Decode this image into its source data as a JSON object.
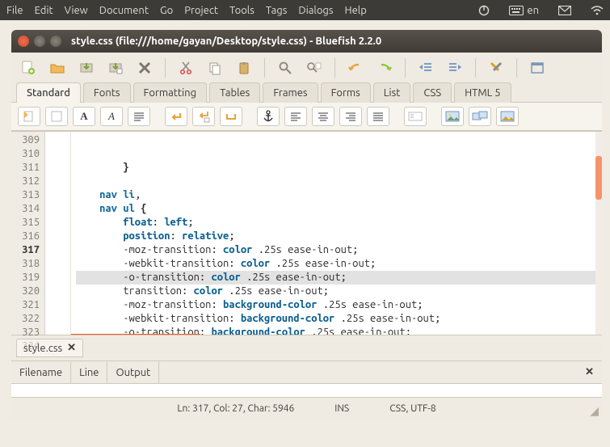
{
  "menubar": {
    "items": [
      "File",
      "Edit",
      "View",
      "Document",
      "Go",
      "Project",
      "Tools",
      "Tags",
      "Dialogs",
      "Help"
    ],
    "lang": "en"
  },
  "window": {
    "title": "style.css (file:///home/gayan/Desktop/style.css) - Bluefish 2.2.0"
  },
  "toolbar_icons": [
    "new-file",
    "open-file",
    "save",
    "save-as",
    "delete",
    "cut",
    "copy",
    "paste",
    "find",
    "find-replace",
    "undo",
    "redo",
    "unindent",
    "indent",
    "preferences",
    "fullscreen"
  ],
  "tabs": [
    "Standard",
    "Fonts",
    "Formatting",
    "Tables",
    "Frames",
    "Forms",
    "List",
    "CSS",
    "HTML 5"
  ],
  "active_tab": 0,
  "toolbar2_icons": [
    "quickstart",
    "body",
    "bold",
    "italic",
    "paragraph",
    "break",
    "nbsp",
    "anchor-in",
    "anchor",
    "align-left",
    "align-center",
    "align-right",
    "align-justify",
    "comment",
    "image",
    "multi-thumb",
    "thumbnail"
  ],
  "editor": {
    "first_line": 309,
    "current_line": 317,
    "lines": [
      {
        "n": 309,
        "seg": [
          {
            "t": "        ",
            "c": "plain"
          },
          {
            "t": "}",
            "c": "brace"
          }
        ]
      },
      {
        "n": 310,
        "seg": []
      },
      {
        "n": 311,
        "seg": [
          {
            "t": "    ",
            "c": "plain"
          },
          {
            "t": "nav li",
            "c": "kw"
          },
          {
            "t": ",",
            "c": "plain"
          }
        ]
      },
      {
        "n": 312,
        "seg": [
          {
            "t": "    ",
            "c": "plain"
          },
          {
            "t": "nav ul ",
            "c": "kw"
          },
          {
            "t": "{",
            "c": "brace"
          }
        ]
      },
      {
        "n": 313,
        "seg": [
          {
            "t": "        ",
            "c": "plain"
          },
          {
            "t": "float",
            "c": "prop"
          },
          {
            "t": ": ",
            "c": "punct"
          },
          {
            "t": "left",
            "c": "val"
          },
          {
            "t": ";",
            "c": "punct"
          }
        ]
      },
      {
        "n": 314,
        "seg": [
          {
            "t": "        ",
            "c": "plain"
          },
          {
            "t": "position",
            "c": "prop"
          },
          {
            "t": ": ",
            "c": "punct"
          },
          {
            "t": "relative",
            "c": "val"
          },
          {
            "t": ";",
            "c": "punct"
          }
        ]
      },
      {
        "n": 315,
        "seg": [
          {
            "t": "        -moz-transition: ",
            "c": "plain"
          },
          {
            "t": "color",
            "c": "val"
          },
          {
            "t": " .25s ease-in-out;",
            "c": "plain"
          }
        ]
      },
      {
        "n": 316,
        "seg": [
          {
            "t": "        -webkit-transition: ",
            "c": "plain"
          },
          {
            "t": "color",
            "c": "val"
          },
          {
            "t": " .25s ease-in-out;",
            "c": "plain"
          }
        ]
      },
      {
        "n": 317,
        "seg": [
          {
            "t": "        -o-transition: ",
            "c": "plain"
          },
          {
            "t": "color",
            "c": "val"
          },
          {
            "t": " .25s ease-in-out;",
            "c": "plain"
          }
        ]
      },
      {
        "n": 318,
        "seg": [
          {
            "t": "        transition: ",
            "c": "plain"
          },
          {
            "t": "color",
            "c": "val"
          },
          {
            "t": " .25s ease-in-out;",
            "c": "plain"
          }
        ]
      },
      {
        "n": 319,
        "seg": [
          {
            "t": "        -moz-transition: ",
            "c": "plain"
          },
          {
            "t": "background-color",
            "c": "val"
          },
          {
            "t": " .25s ease-in-out;",
            "c": "plain"
          }
        ]
      },
      {
        "n": 320,
        "seg": [
          {
            "t": "        -webkit-transition: ",
            "c": "plain"
          },
          {
            "t": "background-color",
            "c": "val"
          },
          {
            "t": " .25s ease-in-out;",
            "c": "plain"
          }
        ]
      },
      {
        "n": 321,
        "seg": [
          {
            "t": "        -o-transition: ",
            "c": "plain"
          },
          {
            "t": "background-color",
            "c": "val"
          },
          {
            "t": " .25s ease-in-out;",
            "c": "plain"
          }
        ]
      },
      {
        "n": 322,
        "seg": [
          {
            "t": "        transition: ",
            "c": "plain"
          },
          {
            "t": "background-color",
            "c": "val"
          },
          {
            "t": " .25s ease-in-out;",
            "c": "plain"
          }
        ]
      },
      {
        "n": 323,
        "seg": [
          {
            "t": "        ",
            "c": "plain"
          },
          {
            "t": "}",
            "c": "brace"
          }
        ]
      }
    ]
  },
  "doc_tab": {
    "label": "style.css"
  },
  "output": {
    "cols": [
      "Filename",
      "Line",
      "Output"
    ]
  },
  "status": {
    "pos": "Ln: 317, Col: 27, Char: 5946",
    "ins": "INS",
    "mode": "CSS, UTF-8"
  }
}
